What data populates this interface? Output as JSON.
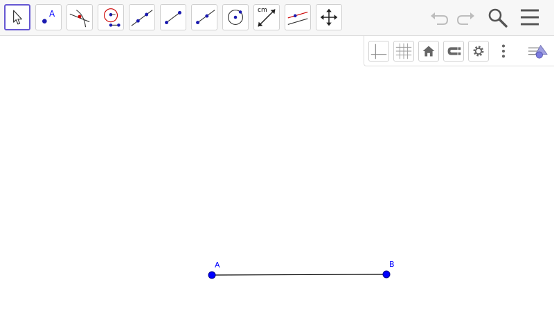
{
  "app": "GeoGebra",
  "toolbar": {
    "tools": [
      {
        "name": "move-tool",
        "icon": "arrow-cursor-icon",
        "selected": true
      },
      {
        "name": "point-tool",
        "icon": "point-icon",
        "label": "A"
      },
      {
        "name": "intersect-tool",
        "icon": "intersect-icon"
      },
      {
        "name": "attach-detach-tool",
        "icon": "attach-point-icon"
      },
      {
        "name": "line-tool",
        "icon": "line-icon"
      },
      {
        "name": "segment-tool",
        "icon": "segment-icon"
      },
      {
        "name": "ray-tool",
        "icon": "ray-icon"
      },
      {
        "name": "circle-tool",
        "icon": "circle-center-point-icon"
      },
      {
        "name": "distance-tool",
        "icon": "distance-icon",
        "label": "cm"
      },
      {
        "name": "parallel-line-tool",
        "icon": "parallel-line-icon"
      },
      {
        "name": "move-view-tool",
        "icon": "move-graphics-view-icon"
      }
    ],
    "undo_icon": "undo-icon",
    "redo_icon": "redo-icon",
    "search_icon": "search-icon",
    "menu_icon": "hamburger-menu-icon"
  },
  "style_bar": {
    "buttons": [
      "axes-toggle-icon",
      "grid-toggle-icon",
      "home-icon",
      "point-capturing-icon",
      "settings-gear-icon",
      "more-vertical-icon"
    ],
    "toggle_icon": "style-bar-toggle-icon"
  },
  "construction": {
    "points": [
      {
        "label": "A",
        "color": "#0000ff"
      },
      {
        "label": "B",
        "color": "#0000ff"
      }
    ],
    "segment": {
      "from": "A",
      "to": "B",
      "color": "#000000"
    }
  },
  "colors": {
    "selection": "#6557d2",
    "point_fill": "#0000ff",
    "accent_red": "#cc0000"
  }
}
